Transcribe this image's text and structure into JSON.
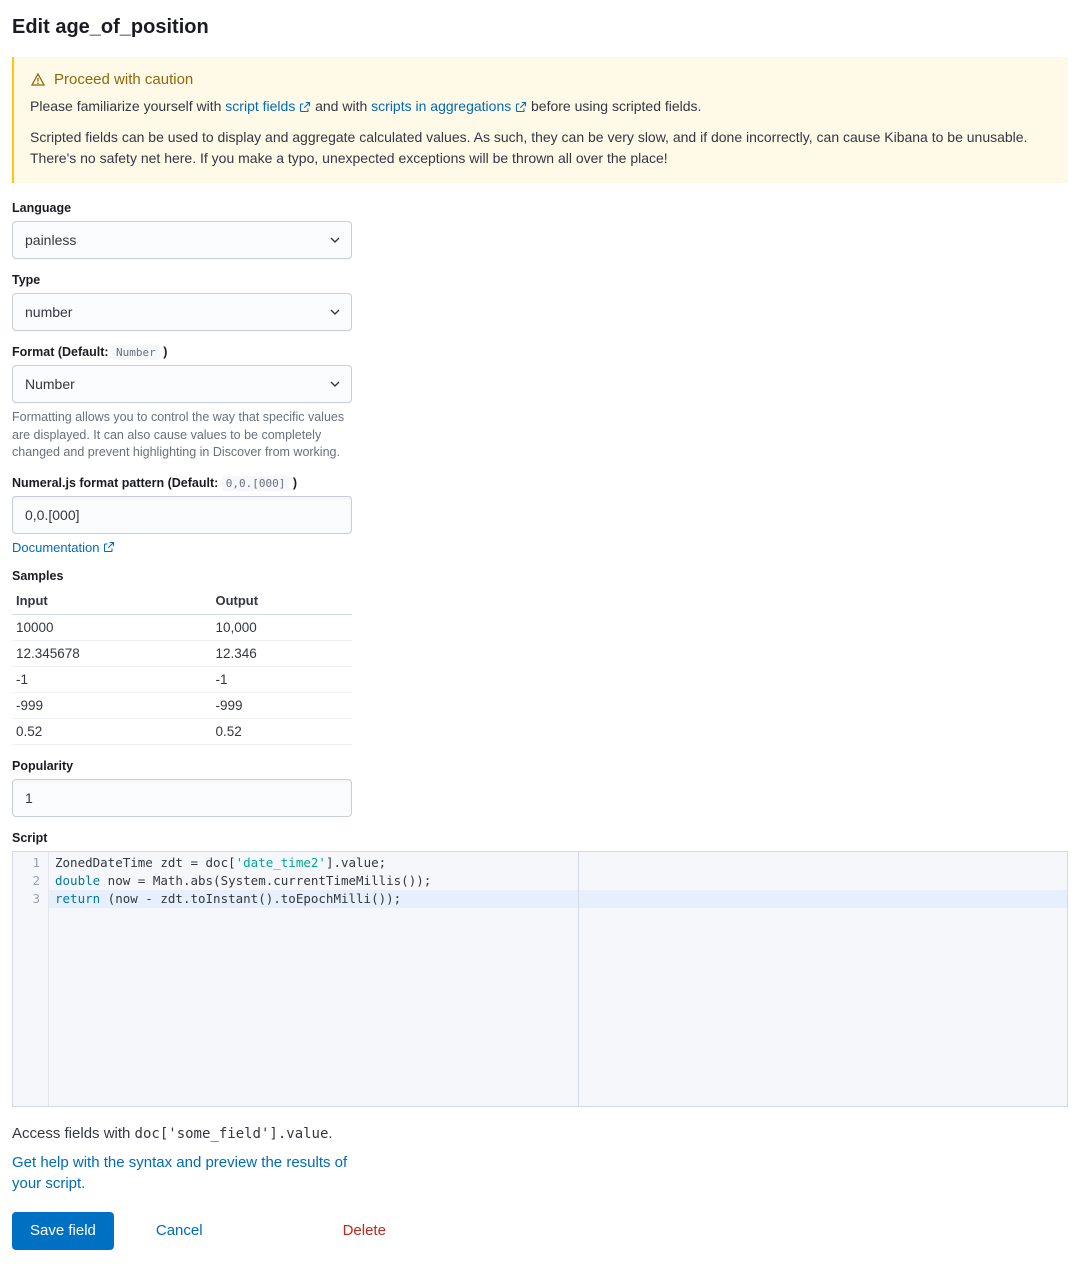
{
  "title": "Edit age_of_position",
  "callout": {
    "heading": "Proceed with caution",
    "p1a": "Please familiarize yourself with ",
    "link1": "script fields",
    "p1b": " and with ",
    "link2": "scripts in aggregations",
    "p1c": " before using scripted fields.",
    "p2": "Scripted fields can be used to display and aggregate calculated values. As such, they can be very slow, and if done incorrectly, can cause Kibana to be unusable. There's no safety net here. If you make a typo, unexpected exceptions will be thrown all over the place!"
  },
  "language": {
    "label": "Language",
    "value": "painless"
  },
  "type": {
    "label": "Type",
    "value": "number"
  },
  "format": {
    "label_pre": "Format (Default: ",
    "default_code": "Number",
    "label_post": " )",
    "value": "Number",
    "help": "Formatting allows you to control the way that specific values are displayed. It can also cause values to be completely changed and prevent highlighting in Discover from working."
  },
  "pattern": {
    "label_pre": "Numeral.js format pattern (Default: ",
    "default_code": "0,0.[000]",
    "label_post": " )",
    "value": "0,0.[000]",
    "doc_link": "Documentation"
  },
  "samples": {
    "label": "Samples",
    "col_input": "Input",
    "col_output": "Output",
    "rows": [
      {
        "in": "10000",
        "out": "10,000"
      },
      {
        "in": "12.345678",
        "out": "12.346"
      },
      {
        "in": "-1",
        "out": "-1"
      },
      {
        "in": "-999",
        "out": "-999"
      },
      {
        "in": "0.52",
        "out": "0.52"
      }
    ]
  },
  "popularity": {
    "label": "Popularity",
    "value": "1"
  },
  "script": {
    "label": "Script",
    "lines": [
      {
        "n": "1",
        "raw_parts": [
          {
            "t": "ZonedDateTime zdt = doc["
          },
          {
            "t": "'date_time2'",
            "cls": "tok-str"
          },
          {
            "t": "].value;"
          }
        ]
      },
      {
        "n": "2",
        "raw_parts": [
          {
            "t": "double",
            "cls": "tok-kw"
          },
          {
            "t": " now = Math.abs(System.currentTimeMillis());"
          }
        ]
      },
      {
        "n": "3",
        "hl": true,
        "raw_parts": [
          {
            "t": "return",
            "cls": "tok-kw"
          },
          {
            "t": " (now - zdt.toInstant().toEpochMilli());"
          }
        ]
      }
    ]
  },
  "access_note": {
    "pre": "Access fields with ",
    "code": "doc['some_field'].value",
    "post": "."
  },
  "help_link": "Get help with the syntax and preview the results of your script.",
  "buttons": {
    "save": "Save field",
    "cancel": "Cancel",
    "delete": "Delete"
  }
}
